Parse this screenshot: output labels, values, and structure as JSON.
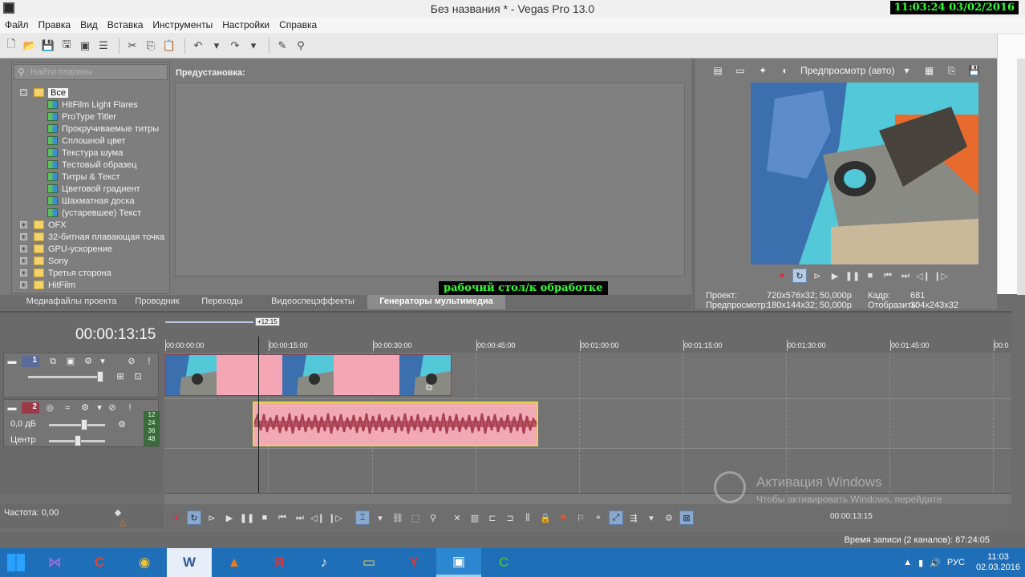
{
  "window": {
    "title": "Без названия * - Vegas Pro 13.0",
    "clock_overlay": "11:03:24  03/02/2016"
  },
  "menu": [
    "Файл",
    "Правка",
    "Вид",
    "Вставка",
    "Инструменты",
    "Настройки",
    "Справка"
  ],
  "plugins": {
    "search_placeholder": "Найти плагины",
    "root": "Все",
    "generators": [
      "HitFilm Light Flares",
      "ProType Titler",
      "Прокручиваемые титры",
      "Сплошной цвет",
      "Текстура шума",
      "Тестовый образец",
      "Титры & Текст",
      "Цветовой градиент",
      "Шахматная доска",
      "(устаревшее) Текст"
    ],
    "folders": [
      "OFX",
      "32-битная плавающая точка",
      "GPU-ускорение",
      "Sony",
      "Третья сторона",
      "HitFilm"
    ],
    "presets_label": "Предустановка:"
  },
  "overlay_label": "рабочий стол/к обработке",
  "tabs": [
    "Медиафайлы проекта",
    "Проводник",
    "Переходы",
    "Видеоспецэффекты",
    "Генераторы мультимедиа"
  ],
  "preview": {
    "mode": "Предпросмотр (авто)",
    "project_label": "Проект:",
    "project_value": "720x576x32; 50,000p",
    "preview_label": "Предпросмотр:",
    "preview_value": "180x144x32; 50,000p",
    "frame_label": "Кадр:",
    "frame_value": "681",
    "display_label": "Отобразить:",
    "display_value": "304x243x32"
  },
  "timeline": {
    "time": "00:00:13:15",
    "playhead_tag": "+12:15",
    "ruler": [
      "00:00:00:00",
      "00:00:15:00",
      "00:00:30:00",
      "00:00:45:00",
      "00:01:00:00",
      "00:01:15:00",
      "00:01:30:00",
      "00:01:45:00",
      "00:0"
    ],
    "tracks": [
      {
        "number": "1",
        "type": "video"
      },
      {
        "number": "2",
        "type": "audio",
        "volume": "0,0 дБ",
        "pan": "Центр"
      }
    ],
    "meter_labels": [
      "12",
      "24",
      "36",
      "48"
    ],
    "rate": "Частота: 0,00",
    "cursor_time": "00:00:13:15"
  },
  "status": {
    "record_time": "Время записи (2 каналов): 87:24:05"
  },
  "watermark": {
    "line1": "Активация Windows",
    "line2": "Чтобы активировать Windows, перейдите"
  },
  "taskbar": {
    "apps": [
      "visual-studio",
      "ccleaner",
      "chrome",
      "word",
      "avast",
      "yandex-disk",
      "audio",
      "explorer",
      "yandex-browser",
      "vegas",
      "camtasia"
    ],
    "app_glyphs": [
      "⋈",
      "C",
      "◉",
      "W",
      "▲",
      "Я",
      "♪",
      "▭",
      "Y",
      "▣",
      "C"
    ],
    "lang": "РУС",
    "time": "11:03",
    "date": "02.03.2016"
  },
  "colors": {
    "taskbar": "#1e6fb8",
    "audio_track": "#9b3a48",
    "video_track": "#5b6c9a",
    "clip": "#f4a6b5",
    "overlay_text": "#2cff2c"
  }
}
